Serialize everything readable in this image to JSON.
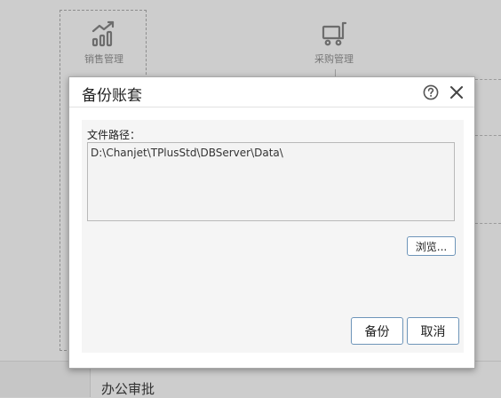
{
  "background": {
    "modules": [
      {
        "label": "销售管理",
        "icon": "sales-chart-icon"
      },
      {
        "label": "采购管理",
        "icon": "purchase-cart-icon"
      }
    ],
    "footer_label": "办公审批"
  },
  "dialog": {
    "title": "备份账套",
    "help_icon": "help-icon",
    "close_icon": "close-icon",
    "path_label": "文件路径：",
    "path_value": "D:\\Chanjet\\TPlusStd\\DBServer\\Data\\",
    "browse_label": "浏览...",
    "backup_label": "备份",
    "cancel_label": "取消"
  },
  "colors": {
    "background": "#cdcdcd",
    "dialog": "#ffffff",
    "dialog_body": "#f5f5f5",
    "button_border": "#6e95b9"
  }
}
